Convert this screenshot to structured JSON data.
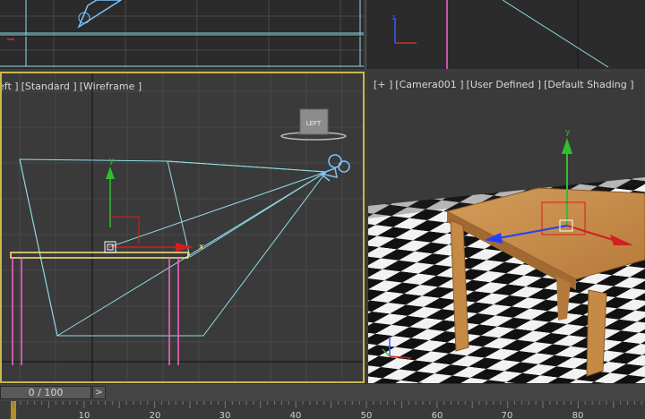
{
  "viewports": {
    "left": {
      "labels": [
        "eft ]",
        "[Standard ]",
        "[Wireframe ]"
      ],
      "viewcube_label": "LEFT",
      "axis_x": "x",
      "axis_y": "y"
    },
    "camera": {
      "labels": [
        "[+ ]",
        "[Camera001 ]",
        "[User Defined ]",
        "[Default Shading ]"
      ],
      "axis_y": "y"
    },
    "top": {},
    "front": {}
  },
  "timeline": {
    "frame_readout": "0 / 100",
    "next_label": ">",
    "ticks": [
      "10",
      "20",
      "30",
      "40",
      "50",
      "60",
      "70",
      "80"
    ]
  },
  "colors": {
    "active_border": "#c9b74a",
    "wire_cyan": "#8fdce8",
    "wire_pink": "#ff5fd0",
    "wire_yellow": "#ffe87a"
  }
}
